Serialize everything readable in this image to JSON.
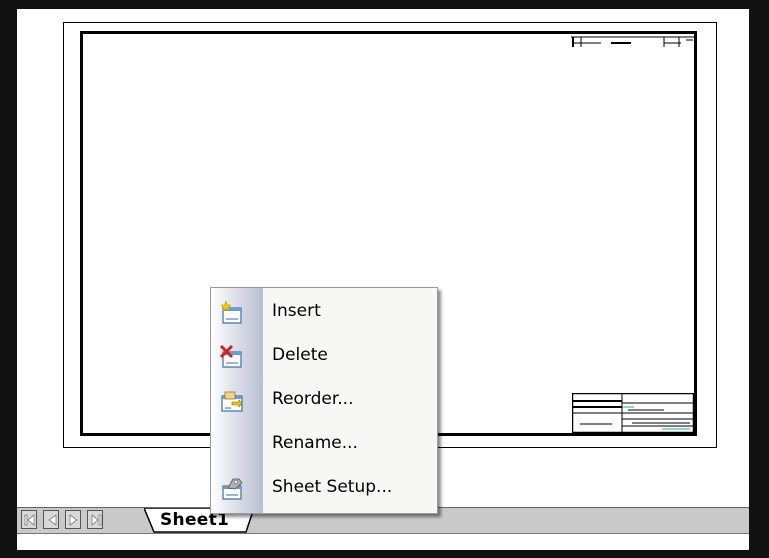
{
  "app": {
    "context_menu": {
      "items": [
        {
          "label": "Insert",
          "icon": "insert-sheet-icon"
        },
        {
          "label": "Delete",
          "icon": "delete-sheet-icon"
        },
        {
          "label": "Reorder...",
          "icon": "reorder-sheets-icon"
        },
        {
          "label": "Rename...",
          "icon": ""
        },
        {
          "label": "Sheet Setup...",
          "icon": "sheet-setup-icon"
        }
      ]
    },
    "tabs": {
      "active_sheet": "Sheet1",
      "nav_buttons": [
        "first-sheet",
        "previous-sheet",
        "next-sheet",
        "last-sheet"
      ]
    },
    "colors": {
      "frame": "#111111",
      "tabbar": "#c9c9c9",
      "menu_bg": "#f7f7f5",
      "menu_strip": "#b9bed2"
    }
  }
}
